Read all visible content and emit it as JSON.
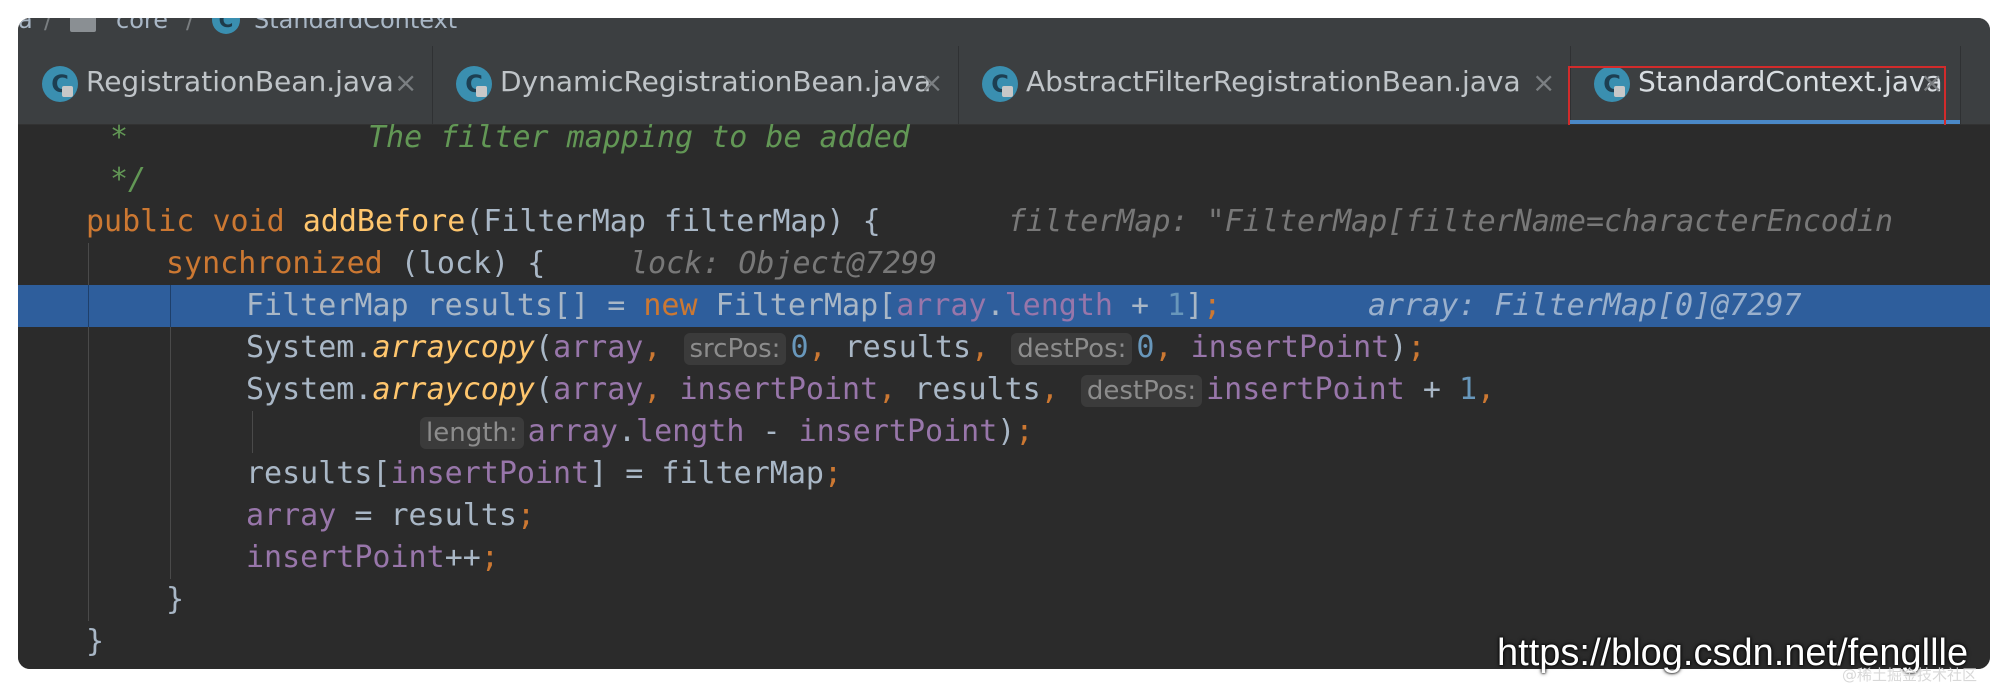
{
  "breadcrumb": {
    "items": [
      "a",
      "core",
      "StandardContext"
    ],
    "separator": "/"
  },
  "tabs": [
    {
      "label": "RegistrationBean.java",
      "active": false,
      "icon": "class-icon"
    },
    {
      "label": "DynamicRegistrationBean.java",
      "active": false,
      "icon": "class-icon"
    },
    {
      "label": "AbstractFilterRegistrationBean.java",
      "active": false,
      "icon": "class-icon"
    },
    {
      "label": "StandardContext.java",
      "active": true,
      "icon": "class-icon"
    }
  ],
  "tab_close_symbol": "×",
  "tab_icon_letter": "C",
  "colors": {
    "editor_bg": "#2b2b2b",
    "current_line": "#2e5e9c",
    "keyword": "#cc7832",
    "method": "#ffc66d",
    "field": "#9876aa",
    "number": "#6897bb",
    "doc_comment": "#629755",
    "highlight_box": "#d22b2b"
  },
  "code": {
    "line1": {
      "star": "*",
      "doc": "The filter mapping to be added"
    },
    "line2": {
      "close": "*/"
    },
    "line3": {
      "kw_public": "public",
      "kw_void": "void",
      "name": "addBefore",
      "open": "(FilterMap filterMap) {",
      "hint": "filterMap: \"FilterMap[filterName=characterEncodin"
    },
    "line4": {
      "kw": "synchronized",
      "text": " (lock) {",
      "hint": "lock: Object@7299"
    },
    "line5": {
      "a": "FilterMap results[] = ",
      "kw_new": "new",
      "b": " FilterMap[",
      "fld": "array",
      "c": ".",
      "fld2": "length",
      "d": " + ",
      "num": "1",
      "e": "]",
      "semi": ";",
      "hint": "array: FilterMap[0]@7297"
    },
    "line6": {
      "a": "System.",
      "method": "arraycopy",
      "b": "(",
      "fld": "array",
      "comma1": ",",
      "p1": "srcPos:",
      "num1": "0",
      "comma2": ",",
      "c": " results",
      "comma3": ",",
      "p2": "destPos:",
      "num2": "0",
      "comma4": ",",
      "fld2": "insertPoint",
      "d": ")",
      "semi": ";"
    },
    "line7": {
      "a": "System.",
      "method": "arraycopy",
      "b": "(",
      "fld": "array",
      "comma1": ",",
      "fld2": "insertPoint",
      "comma2": ",",
      "c": " results",
      "comma3": ",",
      "p": "destPos:",
      "fld3": "insertPoint",
      "d": " + ",
      "num": "1",
      "comma4": ","
    },
    "line8": {
      "p": "length:",
      "fld": "array",
      "a": ".",
      "fld2": "length",
      "b": " - ",
      "fld3": "insertPoint",
      "c": ")",
      "semi": ";"
    },
    "line9": {
      "a": "results[",
      "fld": "insertPoint",
      "b": "] = filterMap",
      "semi": ";"
    },
    "line10": {
      "fld": "array",
      "a": " = results",
      "semi": ";"
    },
    "line11": {
      "fld": "insertPoint",
      "a": "++",
      "semi": ";"
    },
    "line12": {
      "brace": "}"
    },
    "line13": {
      "brace": "}"
    }
  },
  "watermark": "https://blog.csdn.net/fengllle",
  "watermark_small": "@稀土掘金技术社区"
}
